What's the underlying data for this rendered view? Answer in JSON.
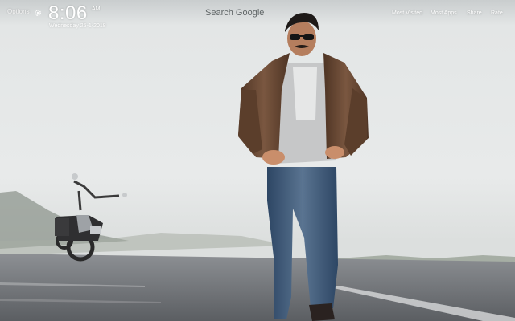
{
  "topbar": {
    "options_label": "Options",
    "time": "8:06",
    "ampm": "AM",
    "date": "Wednesday 25-1-2018",
    "search_placeholder": "Search Google",
    "links": [
      "Most Visited",
      "Most Apps",
      "Share",
      "Rate"
    ]
  },
  "icons": {
    "settings": "gear-icon"
  },
  "colors": {
    "sky": "#dfe2e2",
    "road": "#6f7275",
    "jacket": "#6b4a34",
    "jeans": "#36506e"
  }
}
